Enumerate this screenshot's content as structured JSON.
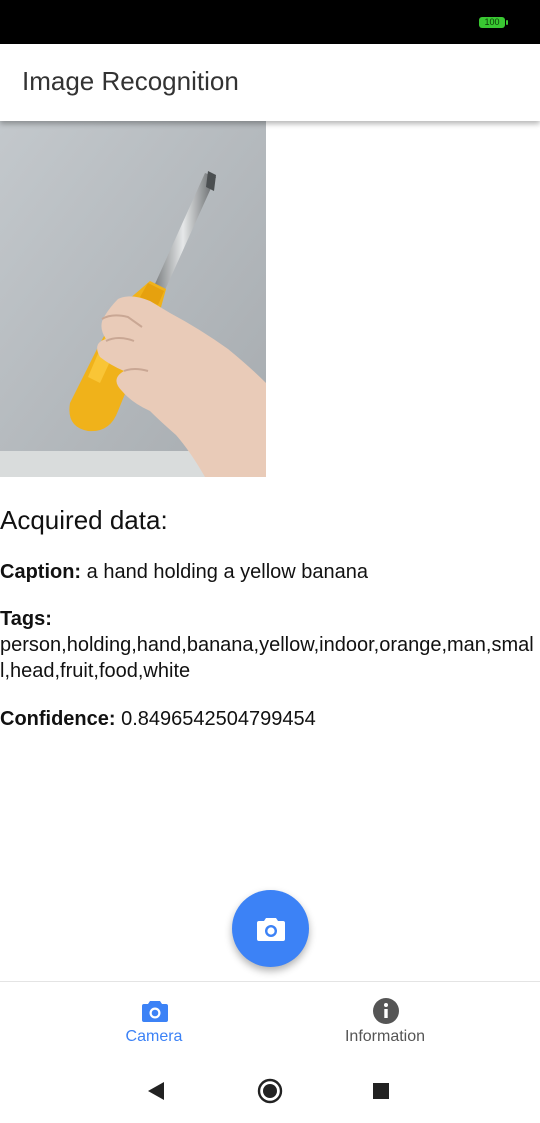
{
  "status_bar": {
    "battery": "100"
  },
  "app_bar": {
    "title": "Image Recognition"
  },
  "photo": {
    "description_icon": "photo-of-hand-holding-yellow-screwdriver"
  },
  "results": {
    "heading": "Acquired data:",
    "caption_label": "Caption:",
    "caption_value": "a hand holding a yellow banana",
    "tags_label": "Tags:",
    "tags_value": "person,holding,hand,banana,yellow,indoor,orange,man,small,head,fruit,food,white",
    "confidence_label": "Confidence:",
    "confidence_value": "0.8496542504799454"
  },
  "fab": {
    "icon": "camera-icon"
  },
  "bottom_nav": {
    "items": [
      {
        "label": "Camera",
        "icon": "camera-icon",
        "active": true
      },
      {
        "label": "Information",
        "icon": "info-icon",
        "active": false
      }
    ]
  },
  "system_nav": {
    "back": "back-icon",
    "home": "home-icon",
    "recents": "recents-icon"
  },
  "colors": {
    "accent": "#3c82f6",
    "battery": "#39c832"
  }
}
